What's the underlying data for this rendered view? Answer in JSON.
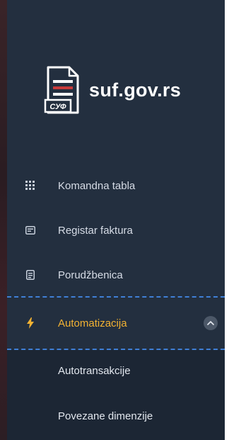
{
  "brand": {
    "name": "suf.gov.rs",
    "logo_text": "СУФ"
  },
  "nav": {
    "items": [
      {
        "label": "Komandna tabla",
        "icon": "grid-icon"
      },
      {
        "label": "Registar faktura",
        "icon": "invoice-icon"
      },
      {
        "label": "Porudžbenica",
        "icon": "order-form-icon"
      },
      {
        "label": "Automatizacija",
        "icon": "lightning-icon",
        "active": true,
        "expanded": true
      }
    ],
    "submenu": [
      {
        "label": "Autotransakcije"
      },
      {
        "label": "Povezane dimenzije"
      }
    ]
  },
  "colors": {
    "sidebar_bg": "#232f3f",
    "submenu_bg": "#1c2634",
    "active_text": "#f2b233",
    "active_border": "#3f7fd6",
    "logo_red": "#c83a3a"
  }
}
